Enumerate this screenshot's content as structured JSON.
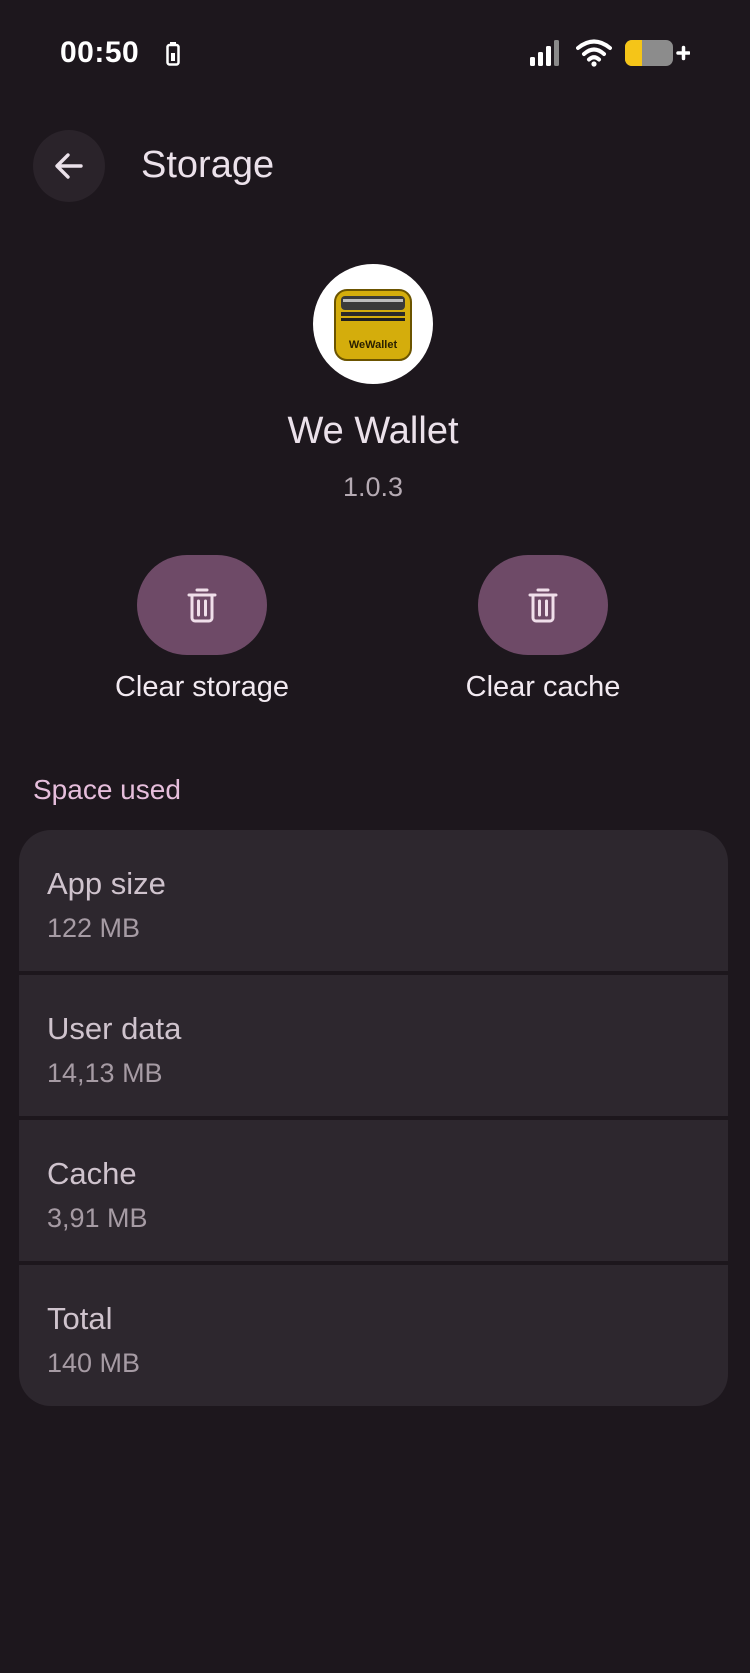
{
  "status_bar": {
    "time": "00:50"
  },
  "app_bar": {
    "title": "Storage"
  },
  "app": {
    "icon_text": "WeWallet",
    "name": "We Wallet",
    "version": "1.0.3"
  },
  "actions": {
    "clear_storage": "Clear storage",
    "clear_cache": "Clear cache"
  },
  "space_used": {
    "label": "Space used",
    "items": [
      {
        "title": "App size",
        "value": "122 MB"
      },
      {
        "title": "User data",
        "value": "14,13 MB"
      },
      {
        "title": "Cache",
        "value": "3,91 MB"
      },
      {
        "title": "Total",
        "value": "140 MB"
      }
    ]
  },
  "colors": {
    "background": "#1d171d",
    "card": "#2d272e",
    "accent_button": "#6e4a67",
    "section_label": "#e6bedc",
    "battery_fill": "#f5c518"
  }
}
